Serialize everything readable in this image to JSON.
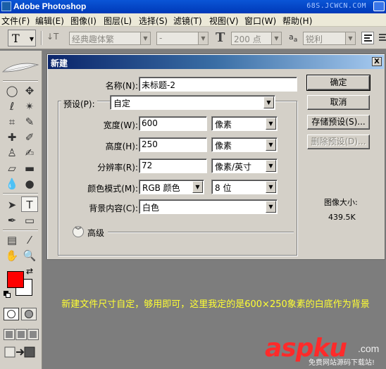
{
  "app": {
    "title": "Adobe Photoshop",
    "watermark_top": "68S.JCWCN.COM"
  },
  "menu": [
    "文件(F)",
    "编辑(E)",
    "图像(I)",
    "图层(L)",
    "选择(S)",
    "滤镜(T)",
    "视图(V)",
    "窗口(W)",
    "帮助(H)"
  ],
  "options": {
    "font_family": "经典趣体繁",
    "font_style": "-",
    "font_size": "200 点",
    "antialias": "锐利"
  },
  "dialog": {
    "title": "新建",
    "close_symbol": "X",
    "name_label": "名称(N):",
    "name_value": "未标题-2",
    "preset_label": "预设(P):",
    "preset_value": "自定",
    "width_label": "宽度(W):",
    "width_value": "600",
    "width_unit": "像素",
    "height_label": "高度(H):",
    "height_value": "250",
    "height_unit": "像素",
    "resolution_label": "分辨率(R):",
    "resolution_value": "72",
    "resolution_unit": "像素/英寸",
    "color_mode_label": "颜色模式(M):",
    "color_mode_value": "RGB 颜色",
    "bit_depth_value": "8 位",
    "background_label": "背景内容(C):",
    "background_value": "白色",
    "advanced_label": "高级",
    "ok_button": "确定",
    "cancel_button": "取消",
    "save_preset_button": "存储预设(S)...",
    "delete_preset_button": "删除预设(D)...",
    "image_size_label": "图像大小:",
    "image_size_value": "439.5K"
  },
  "caption": "新建文件尺寸自定，够用即可，这里我定的是600×250象素的白底作为背景",
  "brand": {
    "name": "aspku",
    "suffix": ".com",
    "subtitle": "免费网站源码下载站!"
  },
  "colors": {
    "foreground": "#ff0000",
    "background": "#ffffff",
    "caption_text": "#ffff33",
    "brand": "#ff2a2a"
  }
}
